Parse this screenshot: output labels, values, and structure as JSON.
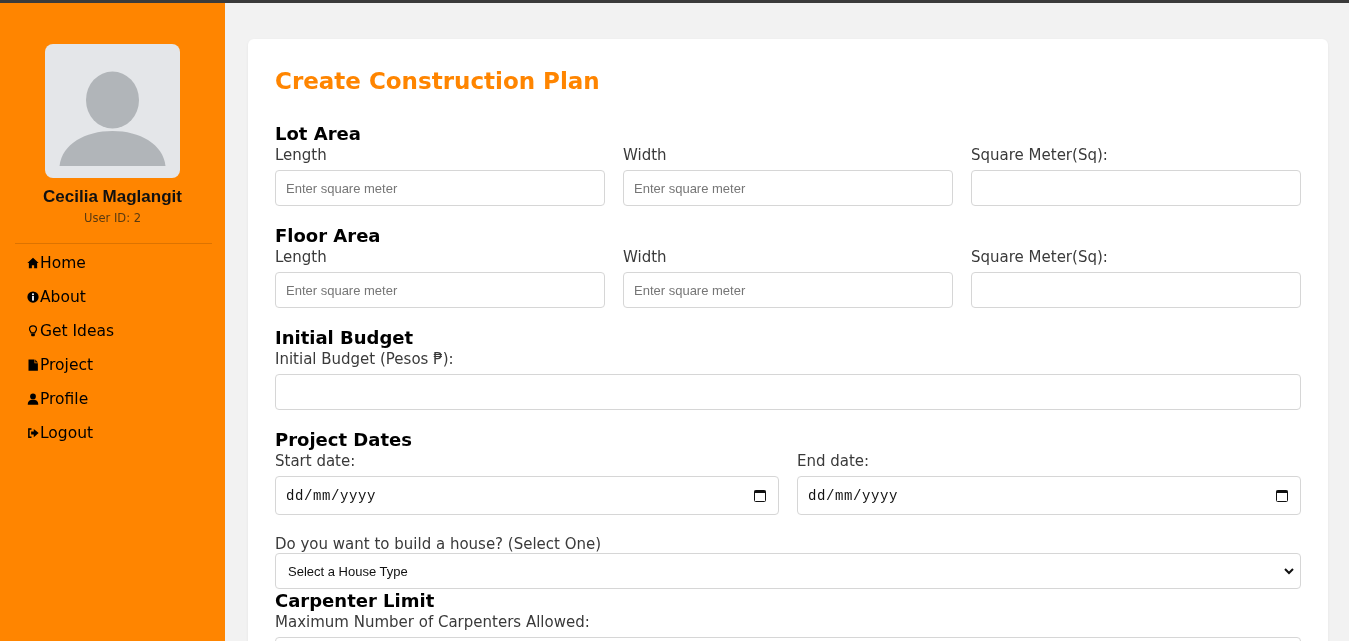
{
  "sidebar": {
    "user": {
      "name": "Cecilia Maglangit",
      "user_id": "User ID: 2"
    },
    "nav": [
      {
        "label": "Home",
        "kind": "home"
      },
      {
        "label": "About",
        "kind": "info"
      },
      {
        "label": "Get Ideas",
        "kind": "bulb"
      },
      {
        "label": "Project",
        "kind": "file"
      },
      {
        "label": "Profile",
        "kind": "user"
      },
      {
        "label": "Logout",
        "kind": "logout"
      }
    ]
  },
  "form": {
    "title": "Create Construction Plan",
    "sections": [
      {
        "heading": "Lot Area",
        "fields": [
          {
            "label": "Length",
            "kind": "text",
            "placeholder": "Enter square meter"
          },
          {
            "label": "Width",
            "kind": "text",
            "placeholder": "Enter square meter"
          },
          {
            "label": "Square Meter(Sq):",
            "kind": "text"
          }
        ]
      },
      {
        "heading": "Floor Area",
        "fields": [
          {
            "label": "Length",
            "kind": "text",
            "placeholder": "Enter square meter"
          },
          {
            "label": "Width",
            "kind": "text",
            "placeholder": "Enter square meter"
          },
          {
            "label": "Square Meter(Sq):",
            "kind": "text"
          }
        ]
      },
      {
        "heading": "Initial Budget",
        "fields": [
          {
            "label": "Initial Budget (Pesos ₱):",
            "kind": "text"
          }
        ]
      },
      {
        "heading": "Project Dates",
        "fields": [
          {
            "label": "Start date:",
            "kind": "date",
            "placeholder": "dd/mm/yyyy"
          },
          {
            "label": "End date:",
            "kind": "date",
            "placeholder": "dd/mm/yyyy"
          }
        ]
      },
      {
        "fields": [
          {
            "label": "Do you want to build a house? (Select One)",
            "kind": "select",
            "value": "Select a House Type"
          }
        ]
      },
      {
        "heading": "Carpenter Limit",
        "fields": [
          {
            "label": "Maximum Number of Carpenters Allowed:",
            "kind": "text"
          }
        ]
      }
    ]
  }
}
